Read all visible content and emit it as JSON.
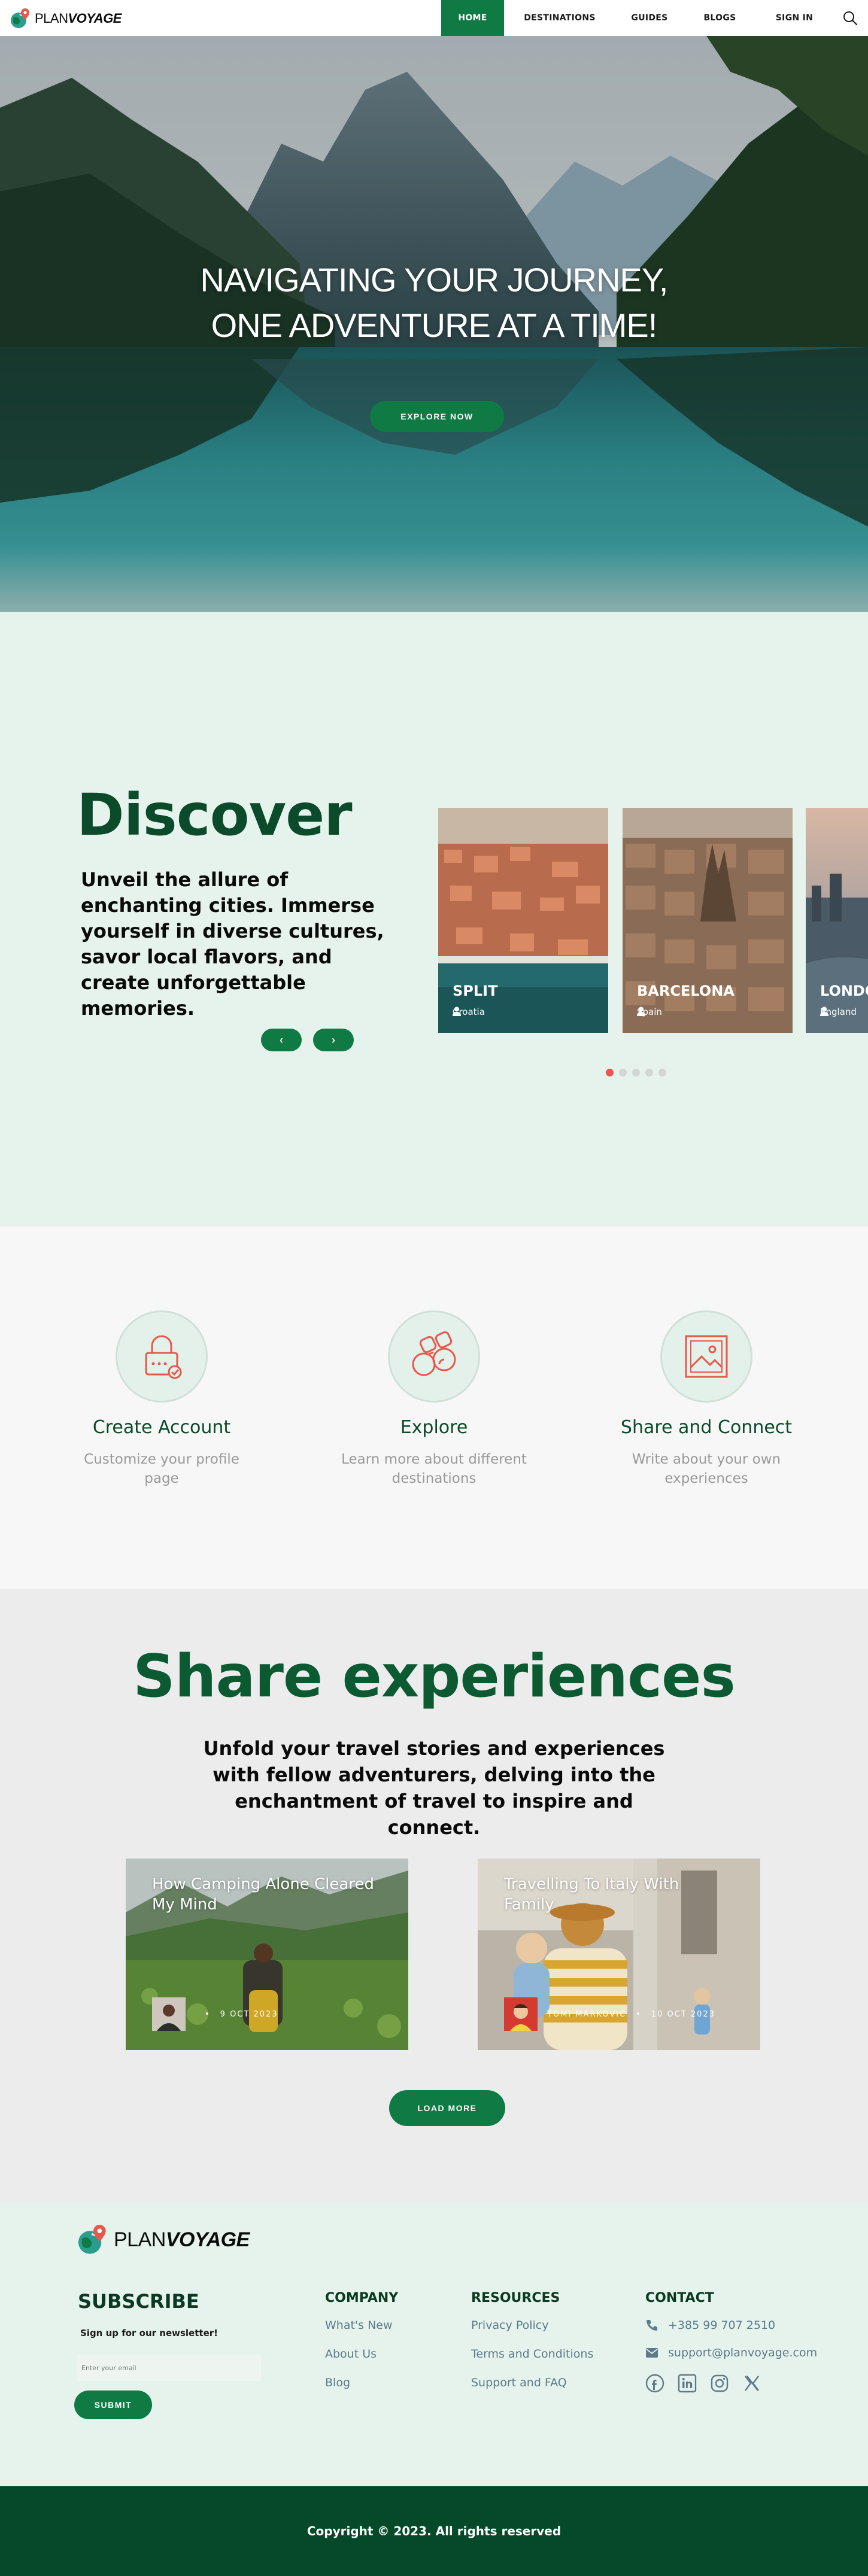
{
  "brand": {
    "name_light": "PLAN",
    "name_bold": "VOYAGE"
  },
  "nav": {
    "items": [
      {
        "label": "HOME",
        "active": true
      },
      {
        "label": "DESTINATIONS",
        "active": false
      },
      {
        "label": "GUIDES",
        "active": false
      },
      {
        "label": "BLOGS",
        "active": false
      },
      {
        "label": "SIGN IN",
        "active": false
      }
    ],
    "search_icon": "search-icon"
  },
  "hero": {
    "title_line1": "NAVIGATING YOUR JOURNEY,",
    "title_line2": "ONE ADVENTURE AT A TIME!",
    "cta": "EXPLORE NOW"
  },
  "discover": {
    "title": "Discover",
    "text": "Unveil the allure of enchanting cities. Immerse yourself in diverse cultures, savor local flavors, and create unforgettable memories.",
    "prev": "‹",
    "next": "›",
    "cities": [
      {
        "name": "SPLIT",
        "country": "Croatia"
      },
      {
        "name": "BARCELONA",
        "country": "Spain"
      },
      {
        "name": "LONDON",
        "country": "England"
      }
    ],
    "dots": 5,
    "active_dot": 0
  },
  "features": [
    {
      "title": "Create Account",
      "desc": "Customize your profile page",
      "icon": "lock-icon"
    },
    {
      "title": "Explore",
      "desc": "Learn more about different destinations",
      "icon": "binoculars-icon"
    },
    {
      "title": "Share and Connect",
      "desc": "Write about your own experiences",
      "icon": "image-icon"
    }
  ],
  "share": {
    "title": "Share experiences",
    "text": "Unfold your travel stories and experiences with fellow adventurers, delving into the enchantment of travel to inspire and connect.",
    "posts": [
      {
        "title": "How Camping Alone Cleared My Mind",
        "author": "",
        "date": "9 OCT 2023"
      },
      {
        "title": "Travelling To Italy With Family",
        "author": "TOMI MARKOVIĆ",
        "date": "10 OCT 2023"
      }
    ],
    "load_more": "LOAD MORE"
  },
  "footer": {
    "subscribe_title": "SUBSCRIBE",
    "subscribe_sub": "Sign up for our newsletter!",
    "email_placeholder": "Enter your email",
    "submit": "SUBMIT",
    "company": {
      "heading": "COMPANY",
      "links": [
        "What's New",
        "About Us",
        "Blog"
      ]
    },
    "resources": {
      "heading": "RESOURCES",
      "links": [
        "Privacy Policy",
        "Terms and Conditions",
        "Support and FAQ"
      ]
    },
    "contact": {
      "heading": "CONTACT",
      "phone": "+385 99 707 2510",
      "email": "support@planvoyage.com"
    },
    "socials": [
      "facebook-icon",
      "linkedin-icon",
      "instagram-icon",
      "x-icon"
    ]
  },
  "copyright": "Copyright © 2023. All rights reserved",
  "colors": {
    "primary": "#0f7a43",
    "dark_green": "#0b4a2a",
    "accent_red": "#e8574b",
    "mint_bg": "#e5f3ec"
  }
}
